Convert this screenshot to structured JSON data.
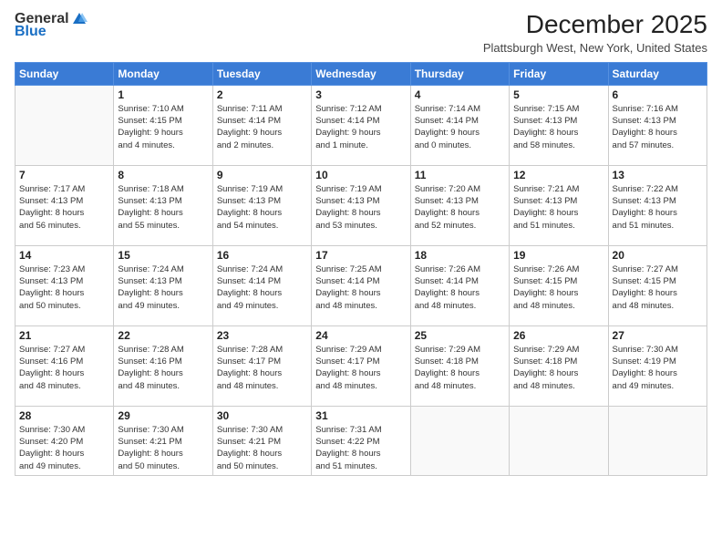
{
  "header": {
    "logo": {
      "general": "General",
      "blue": "Blue"
    },
    "title": "December 2025",
    "location": "Plattsburgh West, New York, United States"
  },
  "weekdays": [
    "Sunday",
    "Monday",
    "Tuesday",
    "Wednesday",
    "Thursday",
    "Friday",
    "Saturday"
  ],
  "weeks": [
    [
      {
        "day": "",
        "info": ""
      },
      {
        "day": "1",
        "info": "Sunrise: 7:10 AM\nSunset: 4:15 PM\nDaylight: 9 hours\nand 4 minutes."
      },
      {
        "day": "2",
        "info": "Sunrise: 7:11 AM\nSunset: 4:14 PM\nDaylight: 9 hours\nand 2 minutes."
      },
      {
        "day": "3",
        "info": "Sunrise: 7:12 AM\nSunset: 4:14 PM\nDaylight: 9 hours\nand 1 minute."
      },
      {
        "day": "4",
        "info": "Sunrise: 7:14 AM\nSunset: 4:14 PM\nDaylight: 9 hours\nand 0 minutes."
      },
      {
        "day": "5",
        "info": "Sunrise: 7:15 AM\nSunset: 4:13 PM\nDaylight: 8 hours\nand 58 minutes."
      },
      {
        "day": "6",
        "info": "Sunrise: 7:16 AM\nSunset: 4:13 PM\nDaylight: 8 hours\nand 57 minutes."
      }
    ],
    [
      {
        "day": "7",
        "info": "Sunrise: 7:17 AM\nSunset: 4:13 PM\nDaylight: 8 hours\nand 56 minutes."
      },
      {
        "day": "8",
        "info": "Sunrise: 7:18 AM\nSunset: 4:13 PM\nDaylight: 8 hours\nand 55 minutes."
      },
      {
        "day": "9",
        "info": "Sunrise: 7:19 AM\nSunset: 4:13 PM\nDaylight: 8 hours\nand 54 minutes."
      },
      {
        "day": "10",
        "info": "Sunrise: 7:19 AM\nSunset: 4:13 PM\nDaylight: 8 hours\nand 53 minutes."
      },
      {
        "day": "11",
        "info": "Sunrise: 7:20 AM\nSunset: 4:13 PM\nDaylight: 8 hours\nand 52 minutes."
      },
      {
        "day": "12",
        "info": "Sunrise: 7:21 AM\nSunset: 4:13 PM\nDaylight: 8 hours\nand 51 minutes."
      },
      {
        "day": "13",
        "info": "Sunrise: 7:22 AM\nSunset: 4:13 PM\nDaylight: 8 hours\nand 51 minutes."
      }
    ],
    [
      {
        "day": "14",
        "info": "Sunrise: 7:23 AM\nSunset: 4:13 PM\nDaylight: 8 hours\nand 50 minutes."
      },
      {
        "day": "15",
        "info": "Sunrise: 7:24 AM\nSunset: 4:13 PM\nDaylight: 8 hours\nand 49 minutes."
      },
      {
        "day": "16",
        "info": "Sunrise: 7:24 AM\nSunset: 4:14 PM\nDaylight: 8 hours\nand 49 minutes."
      },
      {
        "day": "17",
        "info": "Sunrise: 7:25 AM\nSunset: 4:14 PM\nDaylight: 8 hours\nand 48 minutes."
      },
      {
        "day": "18",
        "info": "Sunrise: 7:26 AM\nSunset: 4:14 PM\nDaylight: 8 hours\nand 48 minutes."
      },
      {
        "day": "19",
        "info": "Sunrise: 7:26 AM\nSunset: 4:15 PM\nDaylight: 8 hours\nand 48 minutes."
      },
      {
        "day": "20",
        "info": "Sunrise: 7:27 AM\nSunset: 4:15 PM\nDaylight: 8 hours\nand 48 minutes."
      }
    ],
    [
      {
        "day": "21",
        "info": "Sunrise: 7:27 AM\nSunset: 4:16 PM\nDaylight: 8 hours\nand 48 minutes."
      },
      {
        "day": "22",
        "info": "Sunrise: 7:28 AM\nSunset: 4:16 PM\nDaylight: 8 hours\nand 48 minutes."
      },
      {
        "day": "23",
        "info": "Sunrise: 7:28 AM\nSunset: 4:17 PM\nDaylight: 8 hours\nand 48 minutes."
      },
      {
        "day": "24",
        "info": "Sunrise: 7:29 AM\nSunset: 4:17 PM\nDaylight: 8 hours\nand 48 minutes."
      },
      {
        "day": "25",
        "info": "Sunrise: 7:29 AM\nSunset: 4:18 PM\nDaylight: 8 hours\nand 48 minutes."
      },
      {
        "day": "26",
        "info": "Sunrise: 7:29 AM\nSunset: 4:18 PM\nDaylight: 8 hours\nand 48 minutes."
      },
      {
        "day": "27",
        "info": "Sunrise: 7:30 AM\nSunset: 4:19 PM\nDaylight: 8 hours\nand 49 minutes."
      }
    ],
    [
      {
        "day": "28",
        "info": "Sunrise: 7:30 AM\nSunset: 4:20 PM\nDaylight: 8 hours\nand 49 minutes."
      },
      {
        "day": "29",
        "info": "Sunrise: 7:30 AM\nSunset: 4:21 PM\nDaylight: 8 hours\nand 50 minutes."
      },
      {
        "day": "30",
        "info": "Sunrise: 7:30 AM\nSunset: 4:21 PM\nDaylight: 8 hours\nand 50 minutes."
      },
      {
        "day": "31",
        "info": "Sunrise: 7:31 AM\nSunset: 4:22 PM\nDaylight: 8 hours\nand 51 minutes."
      },
      {
        "day": "",
        "info": ""
      },
      {
        "day": "",
        "info": ""
      },
      {
        "day": "",
        "info": ""
      }
    ]
  ]
}
